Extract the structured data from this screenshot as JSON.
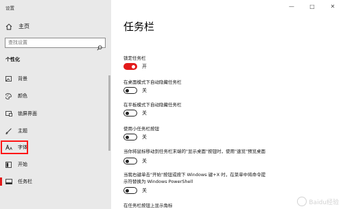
{
  "app": {
    "title": "设置"
  },
  "sidebar": {
    "home_label": "主页",
    "search_placeholder": "查找设置",
    "section_title": "个性化",
    "items": [
      {
        "label": "背景",
        "icon": "picture-icon"
      },
      {
        "label": "颜色",
        "icon": "palette-icon"
      },
      {
        "label": "锁屏界面",
        "icon": "lock-screen-icon"
      },
      {
        "label": "主题",
        "icon": "brush-icon"
      },
      {
        "label": "字体",
        "icon": "font-icon"
      },
      {
        "label": "开始",
        "icon": "start-icon"
      },
      {
        "label": "任务栏",
        "icon": "taskbar-icon",
        "active": true
      }
    ]
  },
  "window_controls": {
    "minimize": "—",
    "maximize": "□",
    "close": "✕"
  },
  "main": {
    "title": "任务栏",
    "settings": [
      {
        "label": "锁定任务栏",
        "state": "开",
        "on": true
      },
      {
        "label": "在桌面模式下自动隐藏任务栏",
        "state": "关",
        "on": false
      },
      {
        "label": "在平板模式下自动隐藏任务栏",
        "state": "关",
        "on": false
      },
      {
        "label": "使用小任务栏按钮",
        "state": "关",
        "on": false
      },
      {
        "label": "当你将鼠标移动到任务栏末端的\"显示桌面\"按钮时，使用\"速览\"预览桌面",
        "state": "关",
        "on": false
      },
      {
        "label_line1": "当我右键单击\"开始\"按钮或按下 Windows 键+X 时，在菜单中将命令提",
        "label_line2": "示符替换为 Windows PowerShell",
        "state": "关",
        "on": false
      },
      {
        "label": "在任务栏按钮上显示角标"
      }
    ]
  },
  "colors": {
    "accent": "#e31a1a",
    "sidebar_bg": "#e9e9e9",
    "highlight_box": "#ff1515"
  },
  "watermark": {
    "text": "Baidu经验"
  }
}
